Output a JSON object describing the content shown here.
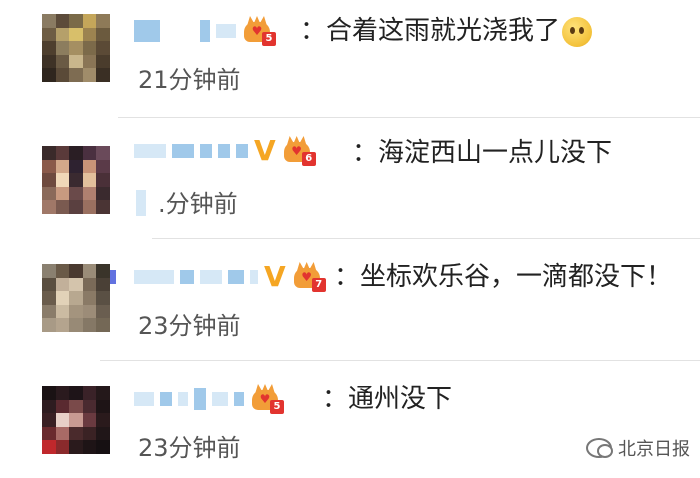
{
  "comments": [
    {
      "level": "5",
      "separator": "：",
      "text": "合着这雨就光浇我了",
      "emoji": "thinking-emoji",
      "time": "21分钟前",
      "vip": false
    },
    {
      "level": "6",
      "separator": "：",
      "text": "海淀西山一点儿没下",
      "time": ".分钟前",
      "vip": true,
      "vip_mark": "V"
    },
    {
      "level": "7",
      "separator": "：",
      "text": "坐标欢乐谷，一滴都没下！",
      "time": "23分钟前",
      "vip": true,
      "vip_mark": "V"
    },
    {
      "level": "5",
      "separator": "：",
      "text": "通州没下",
      "time": "23分钟前",
      "vip": false
    }
  ],
  "watermark": {
    "icon": "wechat-icon",
    "label": "北京日报"
  },
  "colors": {
    "vip": "#f5a623",
    "crown": "#f29d38",
    "level_badge": "#e2342f",
    "name_blur": "#8fbfe6",
    "text": "#222222",
    "time": "#555555"
  }
}
